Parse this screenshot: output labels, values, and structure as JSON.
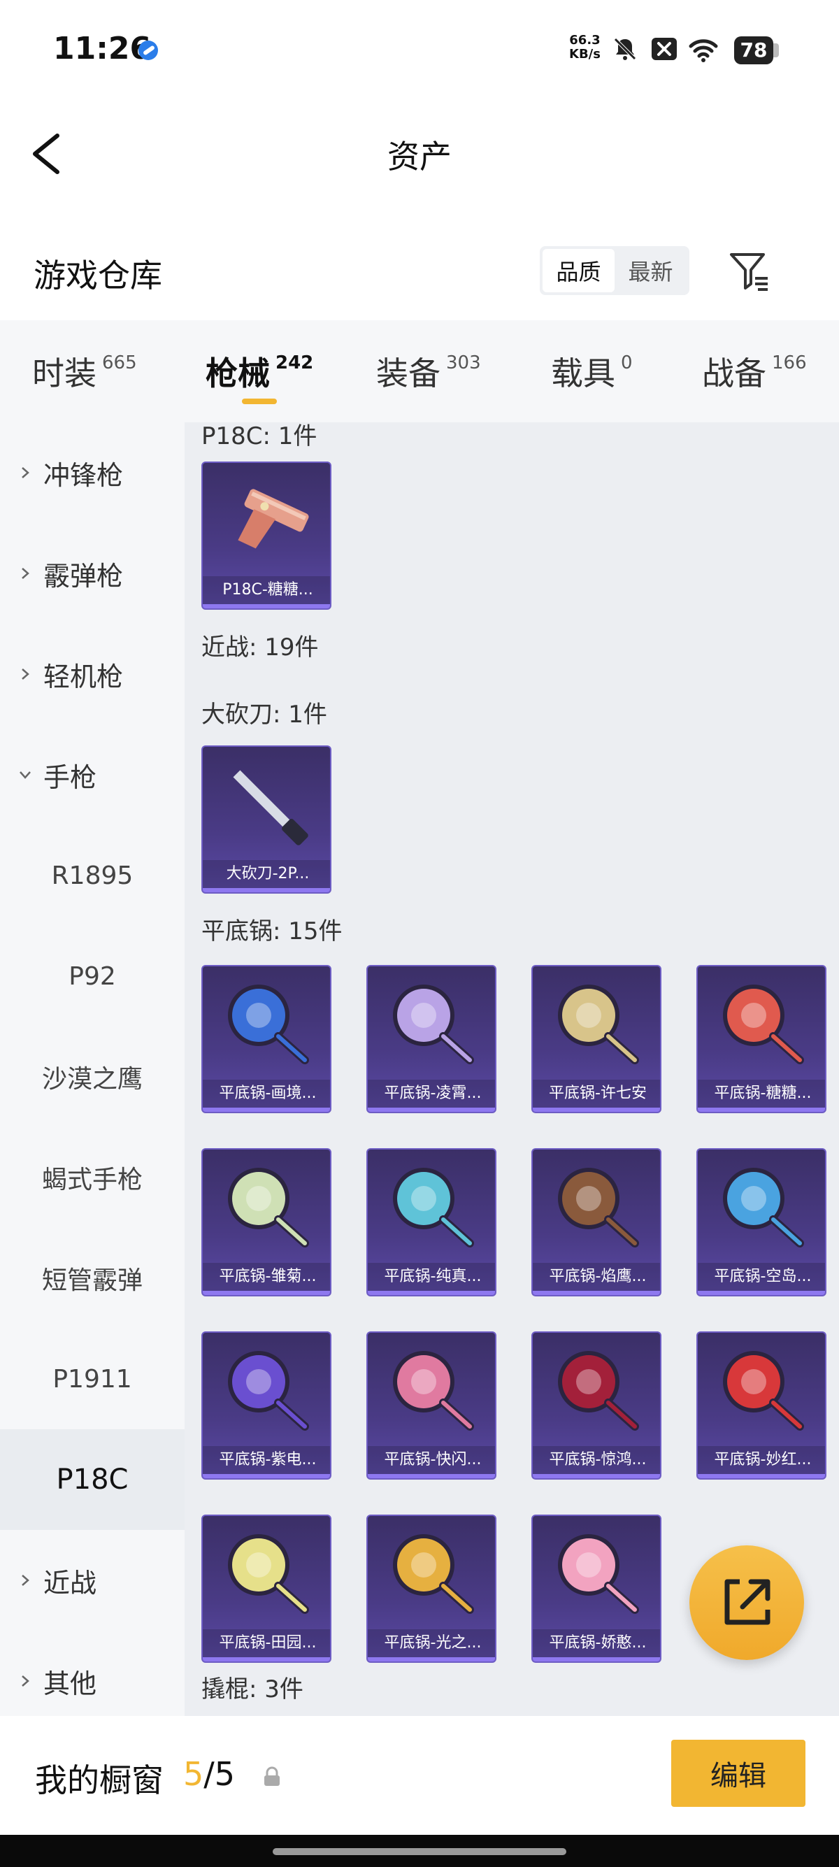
{
  "status_bar": {
    "time": "11:26",
    "speed_value": "66.3",
    "speed_unit": "KB/s",
    "battery": "78"
  },
  "header": {
    "title": "资产"
  },
  "warehouse": {
    "title": "游戏仓库",
    "sort_options": [
      "品质",
      "最新"
    ]
  },
  "tabs": [
    {
      "label": "时装",
      "count": "665"
    },
    {
      "label": "枪械",
      "count": "242"
    },
    {
      "label": "装备",
      "count": "303"
    },
    {
      "label": "载具",
      "count": "0"
    },
    {
      "label": "战备",
      "count": "166"
    }
  ],
  "sidebar": {
    "categories": [
      "冲锋枪",
      "霰弹枪",
      "轻机枪",
      "手枪",
      "近战",
      "其他"
    ],
    "pistol_sub": [
      "R1895",
      "P92",
      "沙漠之鹰",
      "蝎式手枪",
      "短管霰弹",
      "P1911",
      "P18C"
    ]
  },
  "content": {
    "groups": [
      "P18C: 1件",
      "近战: 19件",
      "大砍刀: 1件",
      "平底锅: 15件",
      "撬棍: 3件"
    ],
    "p18c_items": [
      "P18C-糖糖..."
    ],
    "machete_items": [
      "大砍刀-2P..."
    ],
    "pan_items": [
      "平底锅-画境...",
      "平底锅-凌霄...",
      "平底锅-许七安",
      "平底锅-糖糖...",
      "平底锅-雏菊...",
      "平底锅-纯真...",
      "平底锅-焰鹰...",
      "平底锅-空岛...",
      "平底锅-紫电...",
      "平底锅-快闪...",
      "平底锅-惊鸿...",
      "平底锅-妙红...",
      "平底锅-田园...",
      "平底锅-光之...",
      "平底锅-娇憨..."
    ],
    "pan_colors": [
      "#3a6fd8",
      "#b9a3e6",
      "#d8c48a",
      "#e05a4e",
      "#cfe0b5",
      "#5fc3d8",
      "#8a5a3c",
      "#4aa3e0",
      "#6a4fd0",
      "#e07aa0",
      "#a3203a",
      "#d8383a",
      "#e6e08a",
      "#e6b040",
      "#f2a3c0"
    ]
  },
  "bottom": {
    "label": "我的橱窗",
    "current": "5",
    "total": "/5",
    "edit_label": "编辑"
  }
}
